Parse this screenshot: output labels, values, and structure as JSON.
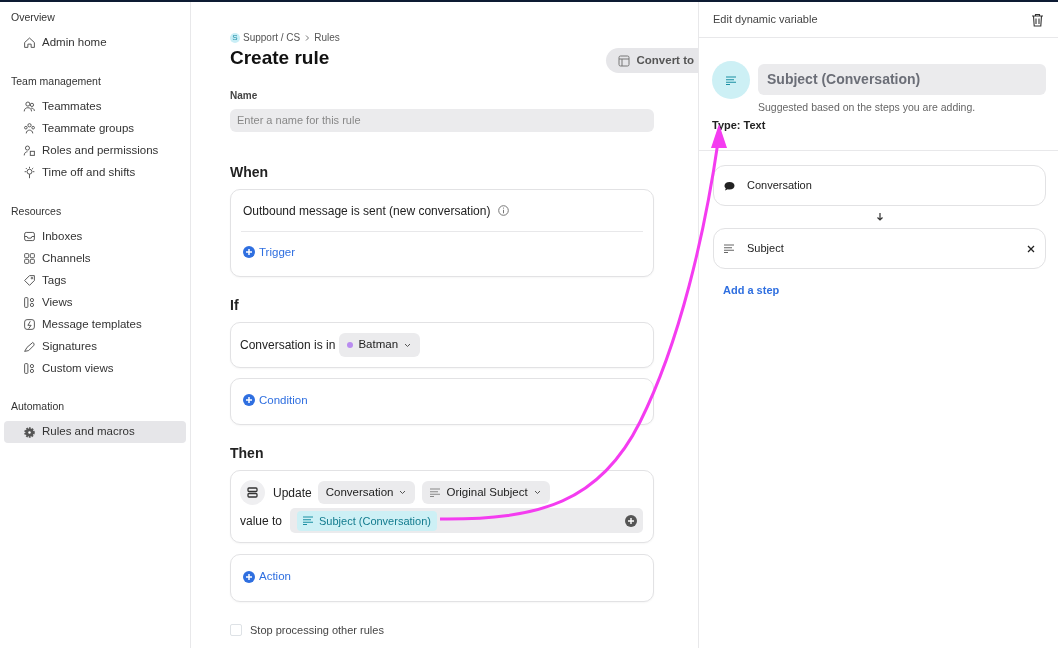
{
  "sidebar": {
    "sections": [
      {
        "title": "Overview",
        "items": [
          {
            "label": "Admin home",
            "selected": false
          }
        ]
      },
      {
        "title": "Team management",
        "items": [
          {
            "label": "Teammates",
            "selected": false
          },
          {
            "label": "Teammate groups",
            "selected": false
          },
          {
            "label": "Roles and permissions",
            "selected": false
          },
          {
            "label": "Time off and shifts",
            "selected": false
          }
        ]
      },
      {
        "title": "Resources",
        "items": [
          {
            "label": "Inboxes",
            "selected": false
          },
          {
            "label": "Channels",
            "selected": false
          },
          {
            "label": "Tags",
            "selected": false
          },
          {
            "label": "Views",
            "selected": false
          },
          {
            "label": "Message templates",
            "selected": false
          },
          {
            "label": "Signatures",
            "selected": false
          },
          {
            "label": "Custom views",
            "selected": false
          }
        ]
      },
      {
        "title": "Automation",
        "items": [
          {
            "label": "Rules and macros",
            "selected": true
          }
        ]
      }
    ]
  },
  "breadcrumb": {
    "workspace_initial": "S",
    "workspace": "Support / CS",
    "page": "Rules"
  },
  "title": "Create rule",
  "convert_button": "Convert to",
  "name_field": {
    "label": "Name",
    "placeholder": "Enter a name for this rule"
  },
  "when": {
    "heading": "When",
    "trigger": "Outbound message is sent (new conversation)",
    "add_label": "Trigger"
  },
  "if": {
    "heading": "If",
    "condition": {
      "prefix": "Conversation is in",
      "value": "Batman",
      "color": "#b98cf0"
    },
    "add_label": "Condition"
  },
  "then": {
    "heading": "Then",
    "action": {
      "verb": "Update",
      "object": "Conversation",
      "field": "Original Subject",
      "value_prefix": "value to",
      "value_chip": "Subject (Conversation)"
    },
    "add_label": "Action"
  },
  "stop_checkbox": {
    "label": "Stop processing other rules",
    "checked": false
  },
  "panel": {
    "title": "Edit dynamic variable",
    "variable_name": "Subject (Conversation)",
    "hint": "Suggested based on the steps you are adding.",
    "type": "Type: Text",
    "steps": [
      {
        "label": "Conversation",
        "kind": "object",
        "removable": false
      },
      {
        "label": "Subject",
        "kind": "field",
        "removable": true
      }
    ],
    "add_step": "Add a step"
  }
}
